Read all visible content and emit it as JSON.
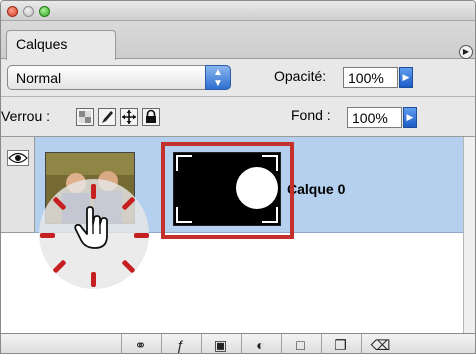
{
  "panel": {
    "tab_label": "Calques",
    "menu_icon": "panel-menu-icon"
  },
  "blend": {
    "mode": "Normal",
    "opacity_label": "Opacité:",
    "opacity_value": "100%"
  },
  "lock": {
    "label": "Verrou :",
    "icons": [
      "lock-transparency-icon",
      "lock-brush-icon",
      "lock-move-icon",
      "lock-all-icon"
    ],
    "fill_label": "Fond :",
    "fill_value": "100%"
  },
  "layer": {
    "name": "Calque 0",
    "visibility_icon": "eye-icon"
  },
  "footer": {
    "icons": [
      "link-icon",
      "fx-icon",
      "mask-icon",
      "adjustment-icon",
      "folder-icon",
      "new-layer-icon",
      "trash-icon"
    ]
  },
  "colors": {
    "selection": "#b5d0ef",
    "highlight": "#c4302b",
    "accent": "#2e6fd1"
  }
}
